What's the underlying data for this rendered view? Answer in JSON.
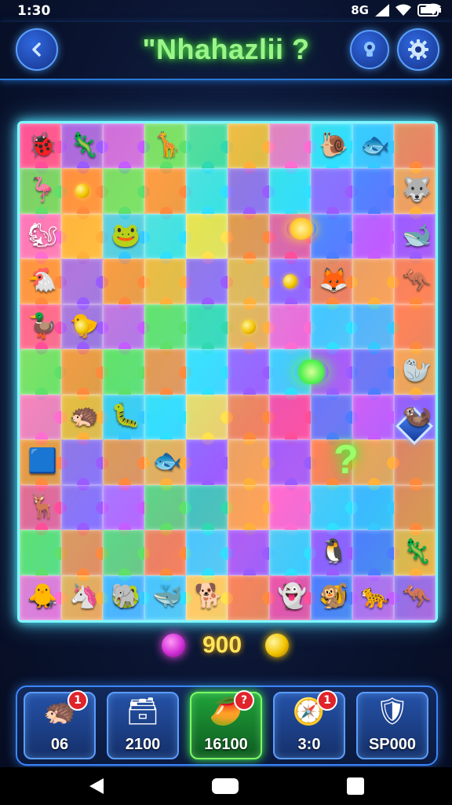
{
  "status_bar": {
    "time": "1:30",
    "network": "8G"
  },
  "header": {
    "title": "\"Nhahazlii ?",
    "back_icon": "chevron-left-icon",
    "hint_icon": "lightbulb-icon",
    "settings_icon": "gear-icon"
  },
  "board": {
    "rows": 11,
    "cols": 10,
    "center_mark": "?",
    "creatures": [
      {
        "row": 0,
        "col": 0,
        "glyph": "🐞"
      },
      {
        "row": 0,
        "col": 1,
        "glyph": "🦎"
      },
      {
        "row": 0,
        "col": 3,
        "glyph": "🦒"
      },
      {
        "row": 0,
        "col": 7,
        "glyph": "🐌"
      },
      {
        "row": 0,
        "col": 8,
        "glyph": "🐟"
      },
      {
        "row": 1,
        "col": 0,
        "glyph": "🦩"
      },
      {
        "row": 1,
        "col": 9,
        "glyph": "🐺"
      },
      {
        "row": 2,
        "col": 0,
        "glyph": "🐿"
      },
      {
        "row": 2,
        "col": 2,
        "glyph": "🐸"
      },
      {
        "row": 2,
        "col": 9,
        "glyph": "🐋"
      },
      {
        "row": 3,
        "col": 0,
        "glyph": "🐔"
      },
      {
        "row": 3,
        "col": 7,
        "glyph": "🦊"
      },
      {
        "row": 3,
        "col": 9,
        "glyph": "🦘"
      },
      {
        "row": 4,
        "col": 0,
        "glyph": "🦆"
      },
      {
        "row": 4,
        "col": 1,
        "glyph": "🐤"
      },
      {
        "row": 5,
        "col": 9,
        "glyph": "🦭"
      },
      {
        "row": 6,
        "col": 1,
        "glyph": "🦔"
      },
      {
        "row": 6,
        "col": 2,
        "glyph": "🐛"
      },
      {
        "row": 6,
        "col": 9,
        "glyph": "🦦"
      },
      {
        "row": 7,
        "col": 0,
        "glyph": "🟦"
      },
      {
        "row": 7,
        "col": 3,
        "glyph": "🐟"
      },
      {
        "row": 8,
        "col": 0,
        "glyph": "🦌"
      },
      {
        "row": 9,
        "col": 9,
        "glyph": "🦎"
      },
      {
        "row": 9,
        "col": 7,
        "glyph": "🐧"
      },
      {
        "row": 10,
        "col": 0,
        "glyph": "🦡"
      },
      {
        "row": 10,
        "col": 2,
        "glyph": "🐸"
      },
      {
        "row": 10,
        "col": 3,
        "glyph": "🐳"
      },
      {
        "row": 10,
        "col": 6,
        "glyph": "🦉"
      },
      {
        "row": 10,
        "col": 7,
        "glyph": "🐠"
      },
      {
        "row": 11,
        "col": 0,
        "glyph": "🐥"
      },
      {
        "row": 11,
        "col": 1,
        "glyph": "🦄"
      },
      {
        "row": 11,
        "col": 2,
        "glyph": "🐘"
      },
      {
        "row": 11,
        "col": 4,
        "glyph": "🐕"
      },
      {
        "row": 11,
        "col": 6,
        "glyph": "👻"
      },
      {
        "row": 11,
        "col": 7,
        "glyph": "🐒"
      },
      {
        "row": 11,
        "col": 8,
        "glyph": "🐆"
      },
      {
        "row": 11,
        "col": 9,
        "glyph": "🦘"
      }
    ],
    "coins": [
      {
        "row": 1,
        "col": 1
      },
      {
        "row": 3,
        "col": 6
      },
      {
        "row": 4,
        "col": 1
      },
      {
        "row": 4,
        "col": 5
      }
    ]
  },
  "score": {
    "value": "900",
    "left_icon": "magenta-orb-icon",
    "right_icon": "gold-coin-icon"
  },
  "powerups": [
    {
      "label": "06",
      "icon": "🦔",
      "badge": "1",
      "active": false,
      "name": "powerup-hedgehog"
    },
    {
      "label": "2100",
      "icon": "🗃",
      "badge": "",
      "active": false,
      "name": "powerup-box"
    },
    {
      "label": "16100",
      "icon": "🥭",
      "badge": "?",
      "active": true,
      "name": "powerup-fruit"
    },
    {
      "label": "3:0",
      "icon": "🧭",
      "badge": "1",
      "active": false,
      "name": "powerup-compass"
    },
    {
      "label": "SP000",
      "icon": "🛡",
      "badge": "",
      "active": false,
      "name": "powerup-shield"
    }
  ],
  "colors": {
    "accent": "#4df0ff",
    "title_glow": "#4fe04a",
    "score": "#ffe45a",
    "badge": "#e0242b"
  }
}
